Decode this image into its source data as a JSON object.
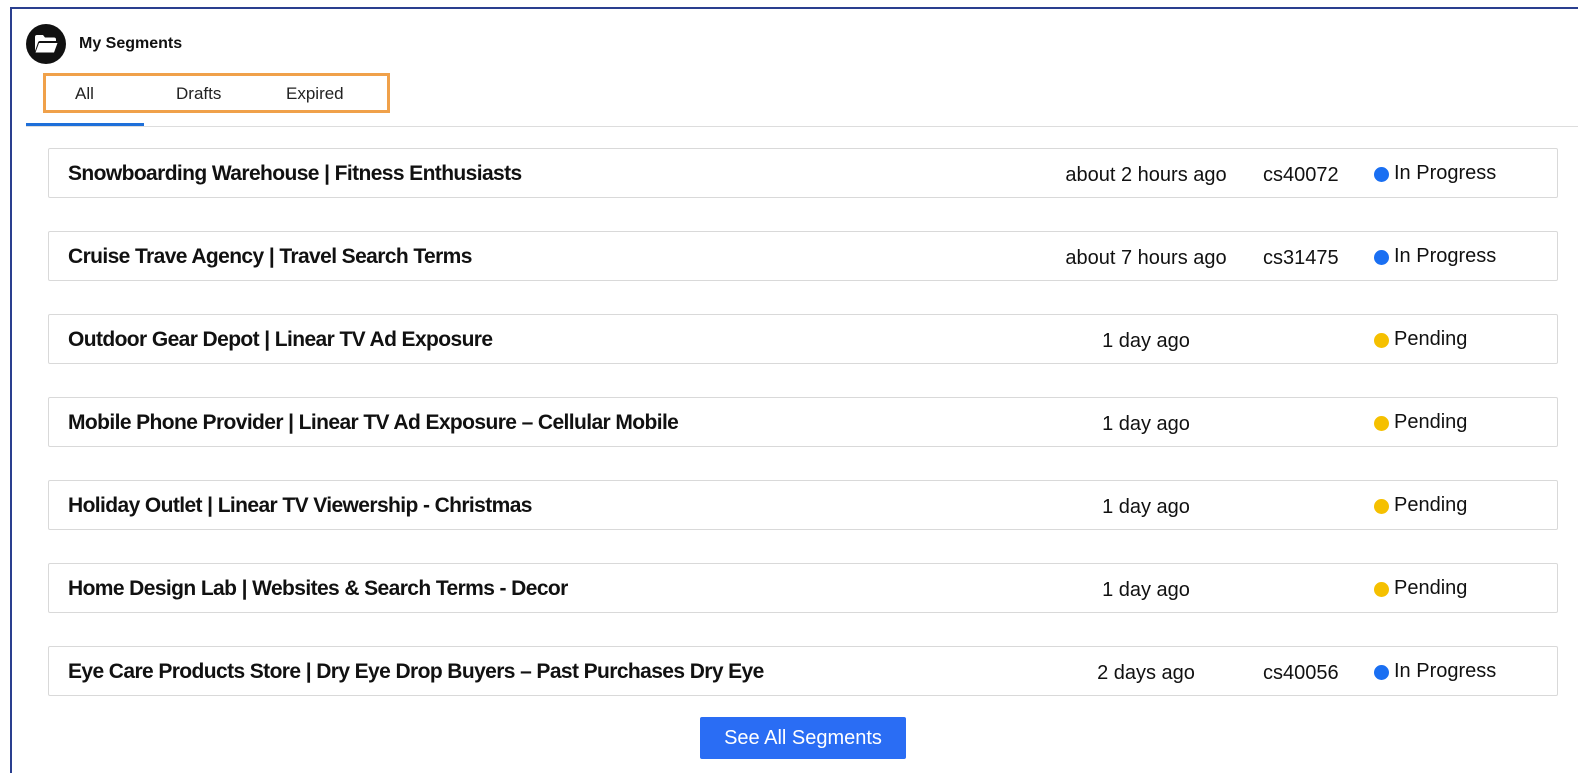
{
  "header": {
    "title": "My Segments",
    "icon": "folder-open-icon"
  },
  "tabs": [
    {
      "label": "All",
      "active": true
    },
    {
      "label": "Drafts",
      "active": false
    },
    {
      "label": "Expired",
      "active": false
    }
  ],
  "segments": [
    {
      "title": "Snowboarding Warehouse | Fitness Enthusiasts",
      "time": "about 2 hours ago",
      "code": "cs40072",
      "status": "In Progress",
      "status_color": "#1a6ff2"
    },
    {
      "title": "Cruise Trave Agency | Travel Search Terms",
      "time": "about 7 hours ago",
      "code": "cs31475",
      "status": "In Progress",
      "status_color": "#1a6ff2"
    },
    {
      "title": "Outdoor Gear Depot | Linear TV Ad Exposure",
      "time": "1 day ago",
      "code": "",
      "status": "Pending",
      "status_color": "#f5c000"
    },
    {
      "title": "Mobile Phone Provider | Linear TV Ad Exposure – Cellular Mobile",
      "time": "1 day ago",
      "code": "",
      "status": "Pending",
      "status_color": "#f5c000"
    },
    {
      "title": "Holiday Outlet | Linear TV Viewership - Christmas",
      "time": "1 day ago",
      "code": "",
      "status": "Pending",
      "status_color": "#f5c000"
    },
    {
      "title": "Home Design Lab | Websites & Search Terms - Decor",
      "time": "1 day ago",
      "code": "",
      "status": "Pending",
      "status_color": "#f5c000"
    },
    {
      "title": "Eye Care Products Store | Dry Eye Drop Buyers – Past Purchases Dry Eye",
      "time": "2 days ago",
      "code": "cs40056",
      "status": "In Progress",
      "status_color": "#1a6ff2"
    }
  ],
  "footer": {
    "see_all_label": "See All Segments",
    "button_color": "#2a6df4"
  },
  "colors": {
    "frame_border": "#2a3f8f",
    "tab_highlight": "#f0a14a",
    "active_tab_underline": "#1e6fd9"
  }
}
